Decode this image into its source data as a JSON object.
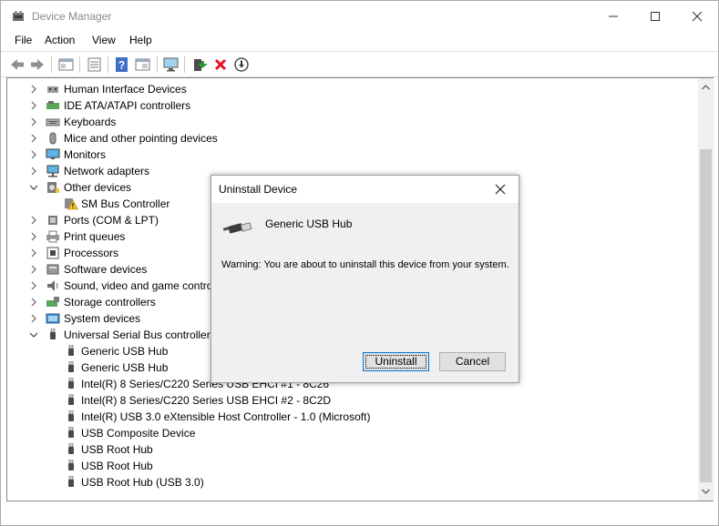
{
  "window": {
    "title": "Device Manager"
  },
  "menu": {
    "items": [
      "File",
      "Action",
      "View",
      "Help"
    ]
  },
  "toolbar": {
    "buttons": [
      "back-icon",
      "forward-icon",
      "show-hidden-icon",
      "properties-icon",
      "help-icon",
      "view-icon",
      "scan-hardware-icon",
      "update-driver-icon",
      "uninstall-icon",
      "disable-icon"
    ]
  },
  "tree": {
    "nodes": [
      {
        "label": "Human Interface Devices",
        "icon": "hid-icon"
      },
      {
        "label": "IDE ATA/ATAPI controllers",
        "icon": "ide-icon"
      },
      {
        "label": "Keyboards",
        "icon": "keyboard-icon"
      },
      {
        "label": "Mice and other pointing devices",
        "icon": "mouse-icon"
      },
      {
        "label": "Monitors",
        "icon": "monitor-icon"
      },
      {
        "label": "Network adapters",
        "icon": "network-icon"
      },
      {
        "label": "Other devices",
        "icon": "other-devices-icon"
      },
      {
        "label": "SM Bus Controller",
        "icon": "warning-device-icon"
      },
      {
        "label": "Ports (COM & LPT)",
        "icon": "port-icon"
      },
      {
        "label": "Print queues",
        "icon": "printer-icon"
      },
      {
        "label": "Processors",
        "icon": "processor-icon"
      },
      {
        "label": "Software devices",
        "icon": "software-icon"
      },
      {
        "label": "Sound, video and game controllers",
        "icon": "sound-icon"
      },
      {
        "label": "Storage controllers",
        "icon": "storage-icon"
      },
      {
        "label": "System devices",
        "icon": "system-icon"
      },
      {
        "label": "Universal Serial Bus controllers",
        "icon": "usb-controller-icon"
      },
      {
        "label": "Generic USB Hub",
        "icon": "usb-icon"
      },
      {
        "label": "Generic USB Hub",
        "icon": "usb-icon"
      },
      {
        "label": "Intel(R) 8 Series/C220 Series USB EHCI #1 - 8C26",
        "icon": "usb-icon"
      },
      {
        "label": "Intel(R) 8 Series/C220 Series USB EHCI #2 - 8C2D",
        "icon": "usb-icon"
      },
      {
        "label": "Intel(R) USB 3.0 eXtensible Host Controller - 1.0 (Microsoft)",
        "icon": "usb-icon"
      },
      {
        "label": "USB Composite Device",
        "icon": "usb-icon"
      },
      {
        "label": "USB Root Hub",
        "icon": "usb-icon"
      },
      {
        "label": "USB Root Hub",
        "icon": "usb-icon"
      },
      {
        "label": "USB Root Hub (USB 3.0)",
        "icon": "usb-icon"
      }
    ]
  },
  "dialog": {
    "title": "Uninstall Device",
    "device_name": "Generic USB Hub",
    "warning": "Warning: You are about to uninstall this device from your system.",
    "uninstall_label": "Uninstall",
    "cancel_label": "Cancel"
  },
  "colors": {
    "accent": "#0078d7",
    "dialog_bg": "#f0f0f0",
    "uninstall_red": "#e81123"
  }
}
